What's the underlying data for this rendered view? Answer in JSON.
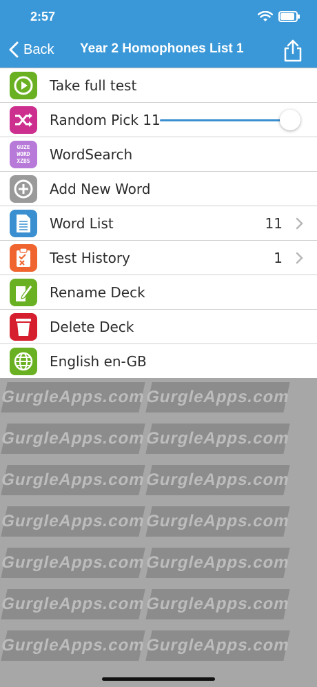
{
  "status": {
    "time": "2:57"
  },
  "nav": {
    "back_label": "Back",
    "title": "Year 2 Homophones List 1"
  },
  "menu": [
    {
      "key": "take-full-test",
      "label": "Take full test",
      "color": "#6ab023",
      "icon": "play-icon"
    },
    {
      "key": "random-pick",
      "label": "Random Pick 11",
      "color": "#cc2f8e",
      "icon": "shuffle-icon"
    },
    {
      "key": "wordsearch",
      "label": "WordSearch",
      "color": "#b77ad9",
      "icon": "wordsearch-icon"
    },
    {
      "key": "add-new-word",
      "label": "Add New Word",
      "color": "#9a9a9a",
      "icon": "plus-circle-icon"
    },
    {
      "key": "word-list",
      "label": "Word List",
      "count": "11",
      "color": "#3a8fd0",
      "icon": "document-icon"
    },
    {
      "key": "test-history",
      "label": "Test History",
      "count": "1",
      "color": "#f0652f",
      "icon": "clipboard-icon"
    },
    {
      "key": "rename-deck",
      "label": "Rename Deck",
      "color": "#6ab023",
      "icon": "pencil-note-icon"
    },
    {
      "key": "delete-deck",
      "label": "Delete Deck",
      "color": "#d61f2e",
      "icon": "trash-icon"
    },
    {
      "key": "language",
      "label": "English en-GB",
      "color": "#6ab023",
      "icon": "globe-icon"
    }
  ],
  "random_pick_slider": {
    "value_fraction": 1.0
  },
  "wordsearch_icon_text": "GUZE WORD XZBS",
  "watermark": "GurgleApps.com"
}
